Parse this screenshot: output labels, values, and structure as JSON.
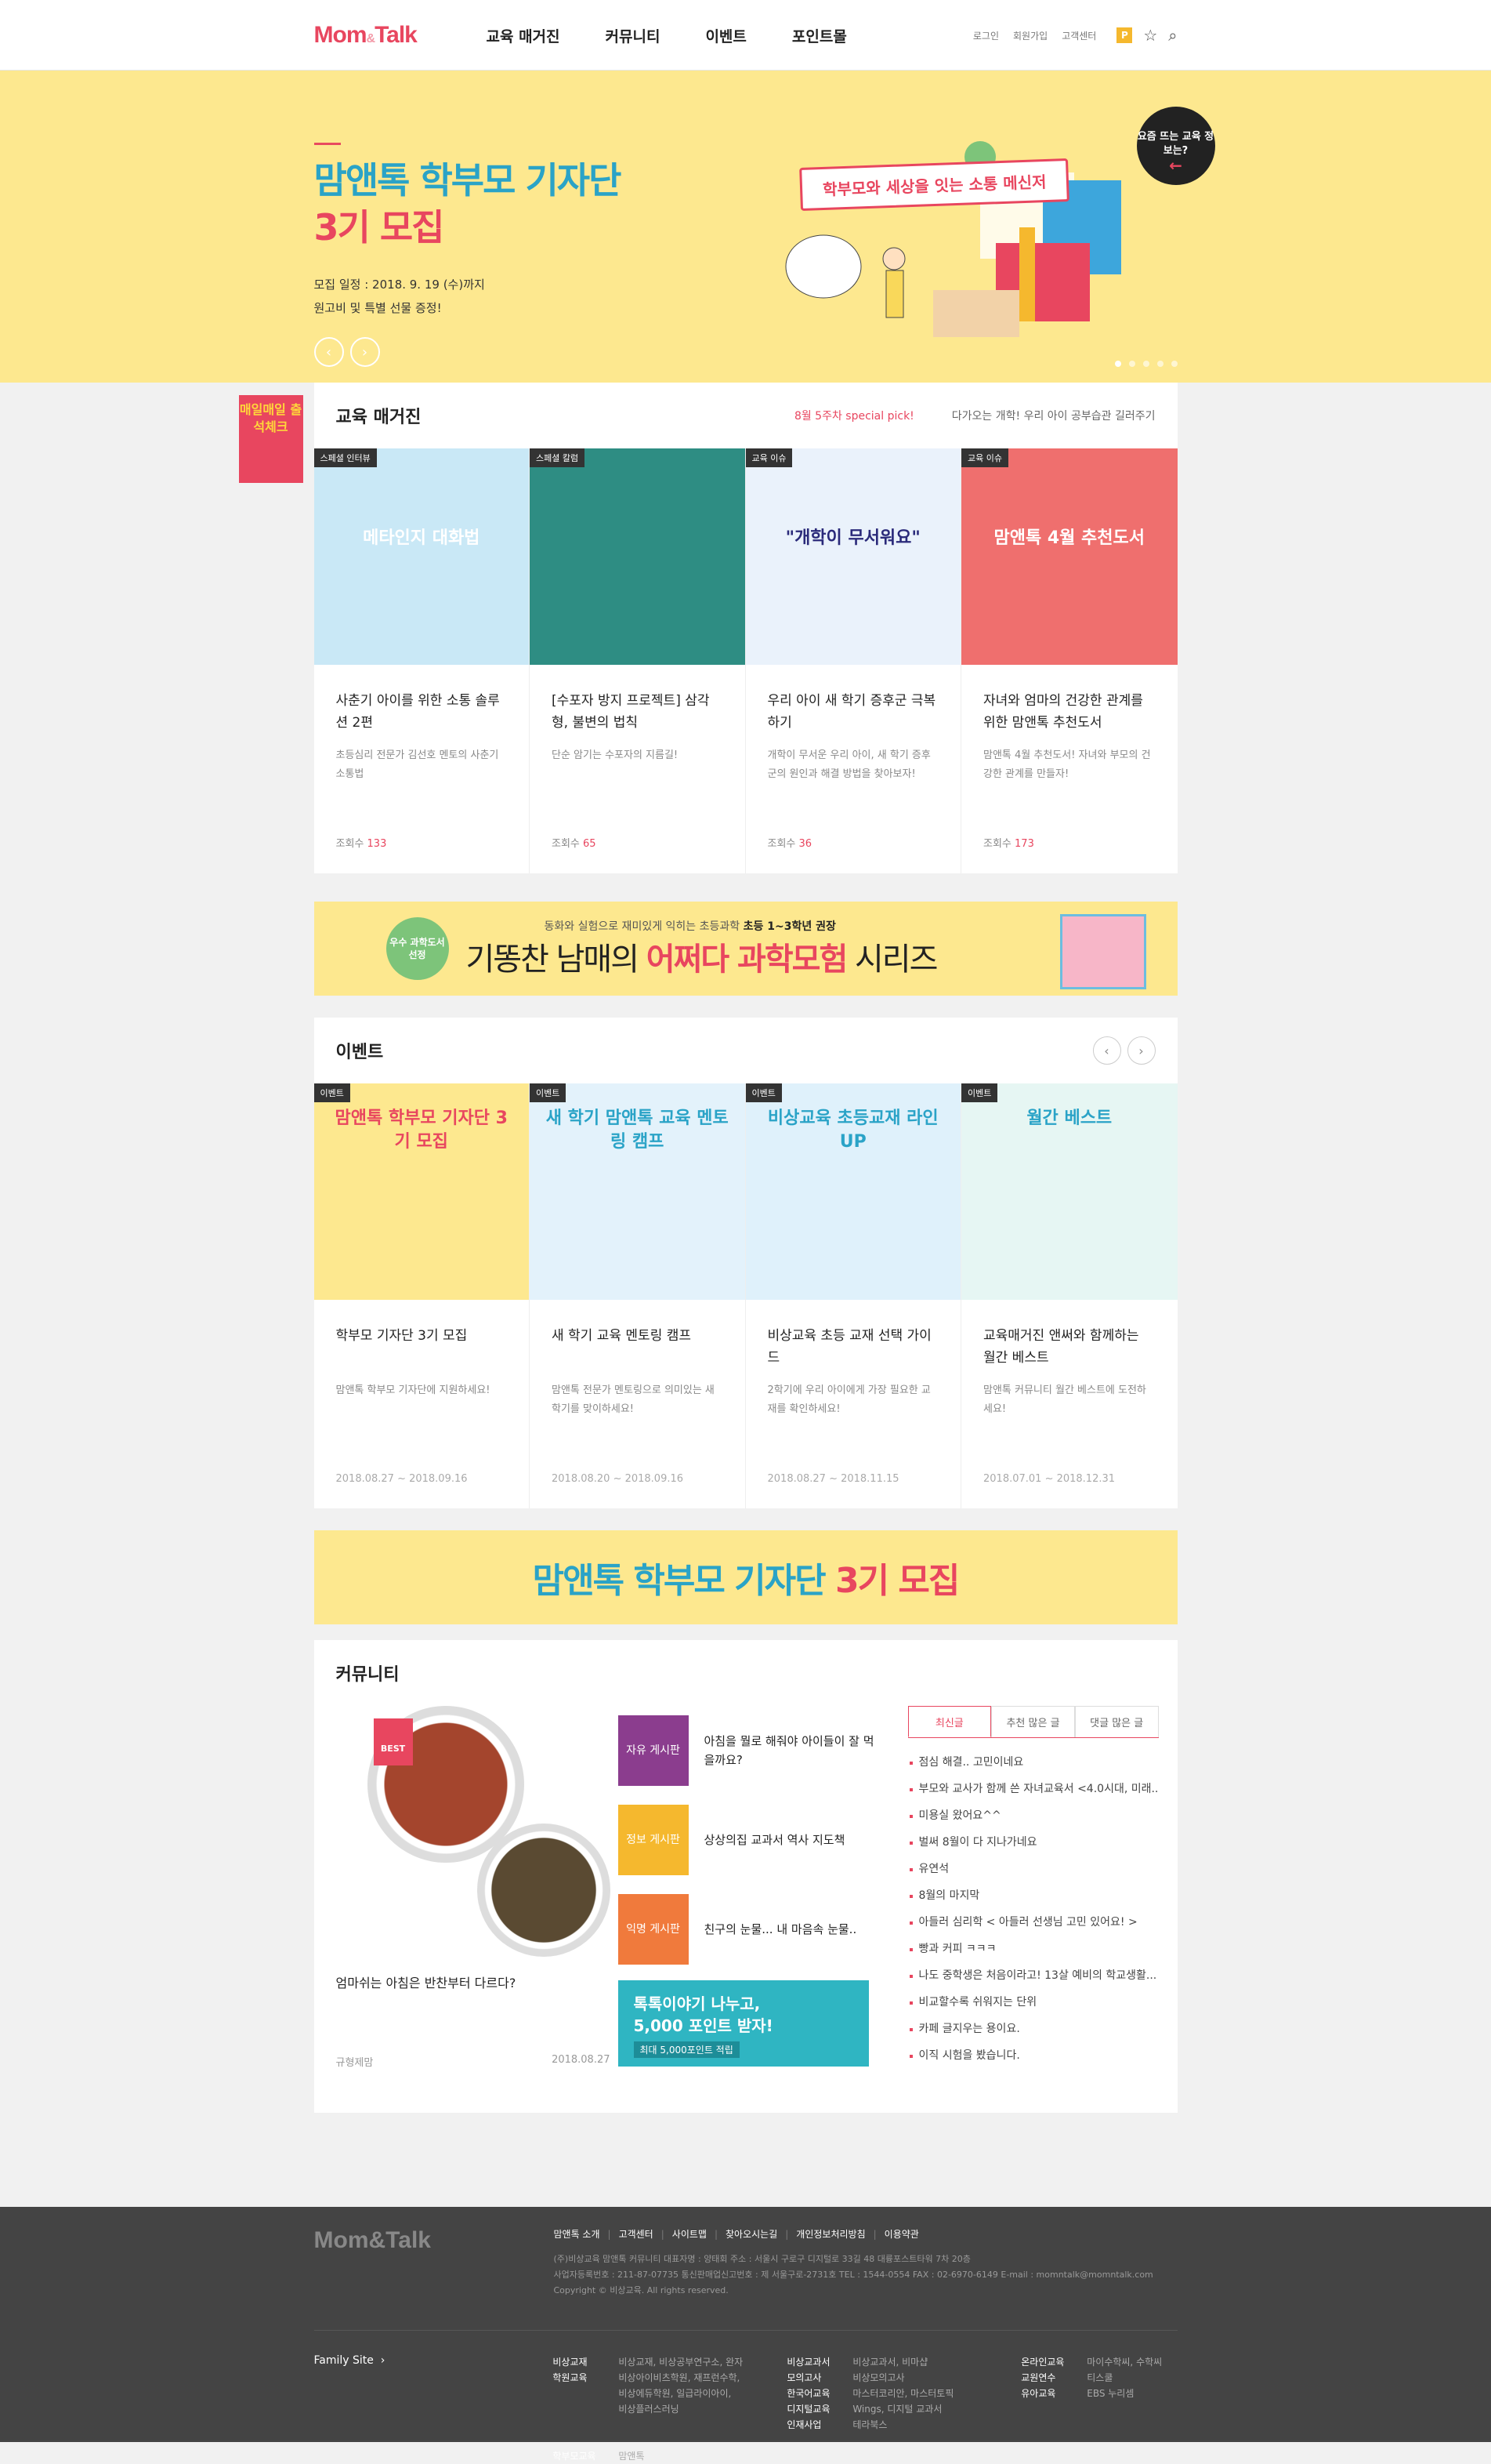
{
  "header": {
    "logo": "Mom",
    "logo_amp": "&",
    "logo2": "Talk",
    "gnb": [
      "교육 매거진",
      "커뮤니티",
      "이벤트",
      "포인트몰"
    ],
    "util": [
      "로그인",
      "회원가입",
      "고객센터"
    ],
    "point_icon": "P"
  },
  "hero": {
    "title1": "맘앤톡 학부모 기자단",
    "title2": "3기 모집",
    "info1": "모집 일정 : 2018. 9. 19 (수)까지",
    "info2": "원고비 및 특별 선물 증정!",
    "ribbon": "학부모와 세상을 잇는 소통 메신저",
    "badge": "요즘 뜨는 교육 정보는?",
    "prev": "‹",
    "next": "›"
  },
  "magazine": {
    "attend": "매일매일 출석체크",
    "heading": "교육 매거진",
    "special": "8월 5주차 special pick!",
    "special_sub": "다가오는 개학! 우리 아이 공부습관 길러주기",
    "cards": [
      {
        "tag": "스페셜 인터뷰",
        "thumb": "메타인지 대화법",
        "title": "사춘기 아이를 위한 소통 솔루션 2편",
        "desc": "초등심리 전문가 김선호 멘토의 사춘기 소통법",
        "views_label": "조회수",
        "views": "133",
        "color": "#c9e8f6"
      },
      {
        "tag": "스페셜 칼럼",
        "thumb": "",
        "title": "[수포자 방지 프로젝트] 삼각형, 불변의 법칙",
        "desc": "단순 암기는 수포자의 지름길!",
        "views_label": "조회수",
        "views": "65",
        "color": "#2e8d83"
      },
      {
        "tag": "교육 이슈",
        "thumb": "\"개학이 무서워요\"",
        "title": "우리 아이 새 학기 증후군 극복하기",
        "desc": "개학이 무서운 우리 아이, 새 학기 증후군의 원인과 해결 방법을 찾아보자!",
        "views_label": "조회수",
        "views": "36",
        "color": "#eaf2fb"
      },
      {
        "tag": "교육 이슈",
        "thumb": "맘앤톡 4월 추천도서",
        "title": "자녀와 엄마의 건강한 관계를 위한 맘앤톡 추천도서",
        "desc": "맘앤톡 4월 추천도서! 자녀와 부모의 건강한 관계를 만들자!",
        "views_label": "조회수",
        "views": "173",
        "color": "#ef6f6e"
      }
    ]
  },
  "banner1": {
    "seal": "우수 과학도서 선정",
    "small": "동화와 실험으로 재미있게 익히는 초등과학 ",
    "small_bold": "초등 1~3학년 권장",
    "large": "기똥찬 남매의 ",
    "large_bold": "어쩌다 과학모험",
    "large_end": " 시리즈"
  },
  "events": {
    "heading": "이벤트",
    "cards": [
      {
        "tag": "이벤트",
        "thumb": "맘앤톡 학부모 기자단 3기 모집",
        "title": "학부모 기자단 3기 모집",
        "desc": "맘앤톡 학부모 기자단에 지원하세요!",
        "date": "2018.08.27 ~ 2018.09.16",
        "color": "#fde88f"
      },
      {
        "tag": "이벤트",
        "thumb": "새 학기 맘앤톡 교육 멘토링 캠프",
        "title": "새 학기 교육 멘토링 캠프",
        "desc": "맘앤톡 전문가 멘토링으로 의미있는 새 학기를 맞이하세요!",
        "date": "2018.08.20 ~ 2018.09.16",
        "color": "#e3f2fb"
      },
      {
        "tag": "이벤트",
        "thumb": "비상교육 초등교재 라인UP",
        "title": "비상교육 초등 교재 선택 가이드",
        "desc": "2학기에 우리 아이에게 가장 필요한 교재를 확인하세요!",
        "date": "2018.08.27 ~ 2018.11.15",
        "color": "#dff1fb"
      },
      {
        "tag": "이벤트",
        "thumb": "월간 베스트",
        "title": "교육매거진 앤써와 함께하는 월간 베스트",
        "desc": "맘앤톡 커뮤니티 월간 베스트에 도전하세요!",
        "date": "2018.07.01 ~ 2018.12.31",
        "color": "#e6f6f3"
      }
    ]
  },
  "banner2": {
    "text": "맘앤톡 학부모 기자단 ",
    "bold": "3기 모집"
  },
  "community": {
    "heading": "커뮤니티",
    "best_label": "BEST",
    "best_caption": "엄마쉬는 아침은 반찬부터 다르다?",
    "best_author": "규형제맘",
    "best_date": "2018.08.27",
    "boards": [
      {
        "icon": "자유 게시판",
        "title": "아침을 뭘로 해줘야 아이들이 잘 먹을까요?",
        "color": "#8b3d8e"
      },
      {
        "icon": "정보 게시판",
        "title": "상상의집 교과서 역사 지도책",
        "color": "#f5b82e"
      },
      {
        "icon": "익명 게시판",
        "title": "친구의 눈물... 내 마음속 눈물..",
        "color": "#f07a3c"
      }
    ],
    "promo_line1": "톡톡이야기 나누고,",
    "promo_line2": "5,000 포인트 받자!",
    "promo_sub": "최대 5,000포인트 적립",
    "tabs": [
      "최신글",
      "추천 많은 글",
      "댓글 많은 글"
    ],
    "posts": [
      "점심 해결.. 고민이네요",
      "부모와 교사가 함께 쓴 자녀교육서 <4.0시대, 미래...",
      "미용실 왔어요^^",
      "벌써 8월이 다 지나가네요",
      "유연석",
      "8월의 마지막",
      "아들러 심리학 < 아들러 선생님 고민 있어요! >",
      "빵과 커피 ㅋㅋㅋ",
      "나도 중학생은 처음이라고! 13살 예비의 학교생활...",
      "비교할수록 쉬워지는 단위",
      "카페 글지우는 용이요.",
      "이직 시험을 봤습니다."
    ]
  },
  "footer": {
    "logo": "Mom&Talk",
    "menu": [
      "맘앤톡 소개",
      "고객센터",
      "사이트맵",
      "찾아오시는길",
      "개인정보처리방침",
      "이용약관"
    ],
    "info1": "(주)비상교육 맘앤톡 커뮤니티   대표자명 : 양태회   주소 : 서울시 구로구 디지털로 33길 48 대륭포스트타워 7차 20층",
    "info2": "사업자등록번호 : 211-87-07735   통신판매업신고번호 : 제 서울구로-2731호   TEL : 1544-0554   FAX : 02-6970-6149   E-mail : momntalk@momntalk.com",
    "copyright": "Copyright © 비상교육. All rights reserved.",
    "family_label": "Family Site",
    "family_arrow": "›",
    "col1_keys": "비상교재\n학원교육\n\n\n\n\n학부모교육",
    "col1_vals": "비상교재, 비상공부연구소, 완자\n비상아이비츠학원, 재프런수학,\n비상에듀학원, 일급라이아이,\n비상플러스러닝\n\n\n맘앤톡",
    "col2_keys": "비상교과서\n모의고사\n한국어교육\n디지털교육\n인재사업",
    "col2_vals": "비상교과서, 비마샵\n비상모의고사\n마스터코리안, 마스터토픽\nWings, 디지털 교과서\n테라북스",
    "col3_keys": "온라인교육\n교원연수\n유아교육",
    "col3_vals": "마이수학씨, 수학씨\n티스쿨\nEBS 누리셈"
  }
}
